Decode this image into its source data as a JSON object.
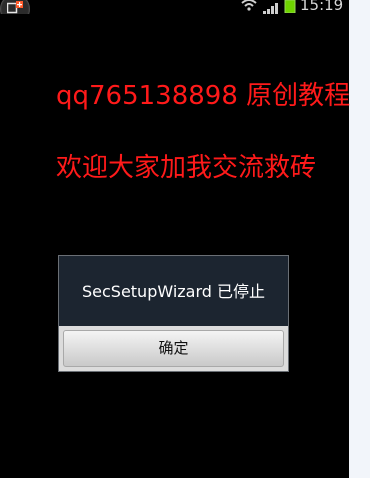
{
  "status_bar": {
    "time": "15:19",
    "icons": [
      "notification-add-icon",
      "wifi-icon",
      "signal-icon",
      "battery-icon"
    ],
    "battery_color": "#6fd400"
  },
  "overlay": {
    "line1": "qq765138898 原创教程",
    "line2": "欢迎大家加我交流救砖",
    "color": "#ff1a1a"
  },
  "dialog": {
    "message": "SecSetupWizard 已停止",
    "ok_label": "确定"
  }
}
